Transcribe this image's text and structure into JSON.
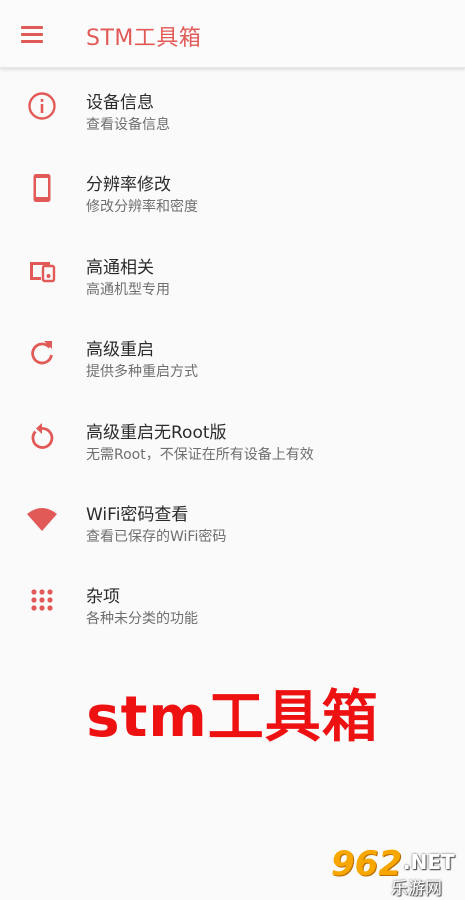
{
  "appbar": {
    "title": "STM工具箱",
    "menu_icon": "hamburger-menu-icon"
  },
  "accent_color": "#e25a57",
  "items": [
    {
      "title": "设备信息",
      "subtitle": "查看设备信息",
      "icon": "info-icon"
    },
    {
      "title": "分辨率修改",
      "subtitle": "修改分辨率和密度",
      "icon": "smartphone-icon"
    },
    {
      "title": "高通相关",
      "subtitle": "高通机型专用",
      "icon": "devices-icon"
    },
    {
      "title": "高级重启",
      "subtitle": "提供多种重启方式",
      "icon": "refresh-icon"
    },
    {
      "title": "高级重启无Root版",
      "subtitle": "无需Root，不保证在所有设备上有效",
      "icon": "restart-icon"
    },
    {
      "title": "WiFi密码查看",
      "subtitle": "查看已保存的WiFi密码",
      "icon": "wifi-icon"
    },
    {
      "title": "杂项",
      "subtitle": "各种未分类的功能",
      "icon": "apps-grid-icon"
    }
  ],
  "promo_text": "stm工具箱",
  "watermark": {
    "number": "962",
    "suffix": ".NET",
    "site": "乐游网"
  }
}
